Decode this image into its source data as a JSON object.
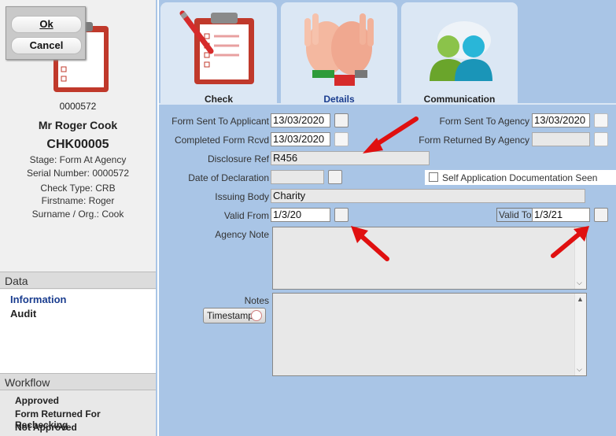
{
  "dialog": {
    "ok_label": "Ok",
    "cancel_label": "Cancel"
  },
  "record": {
    "id_number": "0000572",
    "name": "Mr Roger Cook",
    "code": "CHK00005",
    "stage": "Stage: Form At Agency",
    "serial": "Serial Number: 0000572",
    "check_type": "Check Type: CRB",
    "firstname": "Firstname: Roger",
    "surname": "Surname / Org.: Cook"
  },
  "data_section": {
    "heading": "Data",
    "items": [
      "Information",
      "Audit"
    ]
  },
  "workflow": {
    "heading": "Workflow",
    "items": [
      "Approved",
      "Form Returned For Rechecking",
      "Not Approved"
    ]
  },
  "tabs": [
    {
      "label": "Check",
      "icon": "clipboard-icon"
    },
    {
      "label": "Details",
      "icon": "raised-hands-icon"
    },
    {
      "label": "Communication",
      "icon": "people-icon"
    }
  ],
  "form": {
    "form_sent_to_applicant_label": "Form Sent To Applicant",
    "form_sent_to_applicant": "13/03/2020",
    "form_sent_to_agency_label": "Form Sent To Agency",
    "form_sent_to_agency": "13/03/2020",
    "completed_form_rcvd_label": "Completed Form Rcvd",
    "completed_form_rcvd": "13/03/2020",
    "form_returned_by_agency_label": "Form Returned By Agency",
    "form_returned_by_agency": "",
    "disclosure_ref_label": "Disclosure Ref",
    "disclosure_ref": "R456",
    "date_of_declaration_label": "Date of Declaration",
    "date_of_declaration": "",
    "self_application_label": "Self Application Documentation Seen",
    "issuing_body_label": "Issuing Body",
    "issuing_body": "Charity",
    "valid_from_label": "Valid From",
    "valid_from": "1/3/20",
    "valid_to_label": "Valid To",
    "valid_to": "1/3/21",
    "agency_note_label": "Agency Note",
    "notes_label": "Notes",
    "timestamp_label": "Timestamp"
  },
  "colors": {
    "panel_blue": "#a9c5e6",
    "tab_bg": "#dbe7f4",
    "arrow_red": "#e01010",
    "link_blue": "#1a3d8f"
  }
}
